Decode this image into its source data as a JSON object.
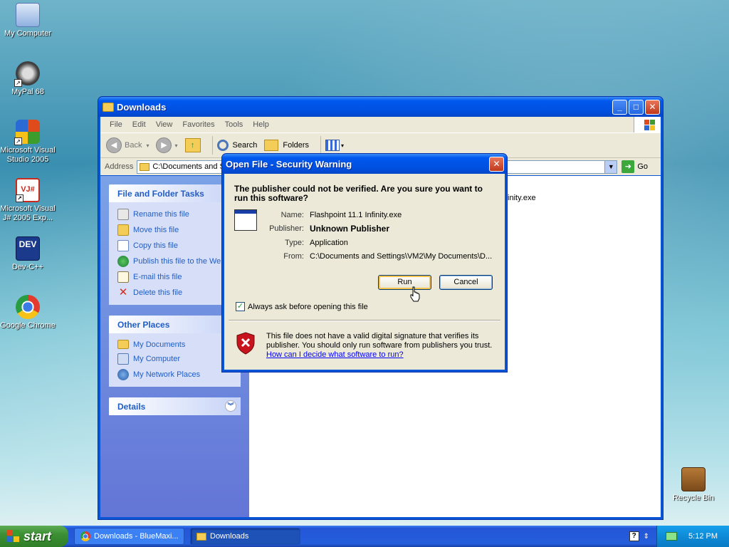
{
  "desktop": {
    "icons": [
      {
        "label": "My Computer"
      },
      {
        "label": "MyPal 68"
      },
      {
        "label": "Microsoft Visual Studio 2005"
      },
      {
        "label": "Microsoft Visual J# 2005 Exp..."
      },
      {
        "label": "Dev-C++"
      },
      {
        "label": "Google Chrome"
      },
      {
        "label": "Recycle Bin"
      }
    ],
    "dev_icon_text": "DEV",
    "vj_icon_text": "VJ#"
  },
  "explorer": {
    "title": "Downloads",
    "menu": [
      "File",
      "Edit",
      "View",
      "Favorites",
      "Tools",
      "Help"
    ],
    "toolbar": {
      "back": "Back",
      "search": "Search",
      "folders": "Folders"
    },
    "address_label": "Address",
    "address_value": "C:\\Documents and S",
    "go_label": "Go",
    "file_fragment": "finity.exe",
    "file_tasks": {
      "title": "File and Folder Tasks",
      "items": [
        "Rename this file",
        "Move this file",
        "Copy this file",
        "Publish this file to the Web",
        "E-mail this file",
        "Delete this file"
      ]
    },
    "other_places": {
      "title": "Other Places",
      "items": [
        "My Documents",
        "My Computer",
        "My Network Places"
      ]
    },
    "details": {
      "title": "Details"
    }
  },
  "dialog": {
    "title": "Open File - Security Warning",
    "question": "The publisher could not be verified.  Are you sure you want to run this software?",
    "fields": [
      {
        "key": "Name:",
        "value": "Flashpoint 11.1 Infinity.exe"
      },
      {
        "key": "Publisher:",
        "value": "Unknown Publisher"
      },
      {
        "key": "Type:",
        "value": "Application"
      },
      {
        "key": "From:",
        "value": "C:\\Documents and Settings\\VM2\\My Documents\\D..."
      }
    ],
    "run_label": "Run",
    "cancel_label": "Cancel",
    "checkbox_label": "Always ask before opening this file",
    "checkbox_checked": true,
    "warning_text": "This file does not have a valid digital signature that verifies its publisher.  You should only run software from publishers you trust.",
    "warning_link": "How can I decide what software to run?"
  },
  "taskbar": {
    "start_label": "start",
    "tasks": [
      {
        "label": "Downloads - BlueMaxi..."
      },
      {
        "label": "Downloads"
      }
    ],
    "clock": "5:12 PM"
  }
}
